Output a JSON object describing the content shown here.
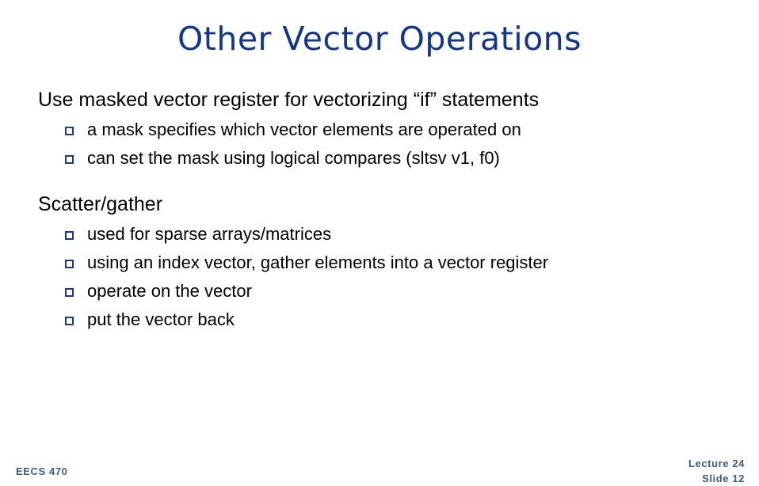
{
  "slide": {
    "title": "Other Vector Operations",
    "title_color": "#13368C",
    "background_color": "#FFFFFF",
    "body_text_color": "#000000",
    "bullet_marker_color": "#1F3D70",
    "footer_color": "#3F5D79",
    "bullet_marker_icon": "hollow-square-bullet-icon",
    "blocks": [
      {
        "heading": "Use masked vector register for vectorizing “if” statements",
        "subitems": [
          "a mask specifies which vector elements are operated on",
          "can set the mask using logical compares (sltsv v1, f0)"
        ]
      },
      {
        "heading": "Scatter/gather",
        "subitems": [
          "used for sparse arrays/matrices",
          "using an index vector, gather elements into a vector register",
          "operate on the vector",
          "put the vector back"
        ]
      }
    ]
  },
  "footer": {
    "course": "EECS 470",
    "lecture": "Lecture 24",
    "slide_number": "Slide 12"
  }
}
